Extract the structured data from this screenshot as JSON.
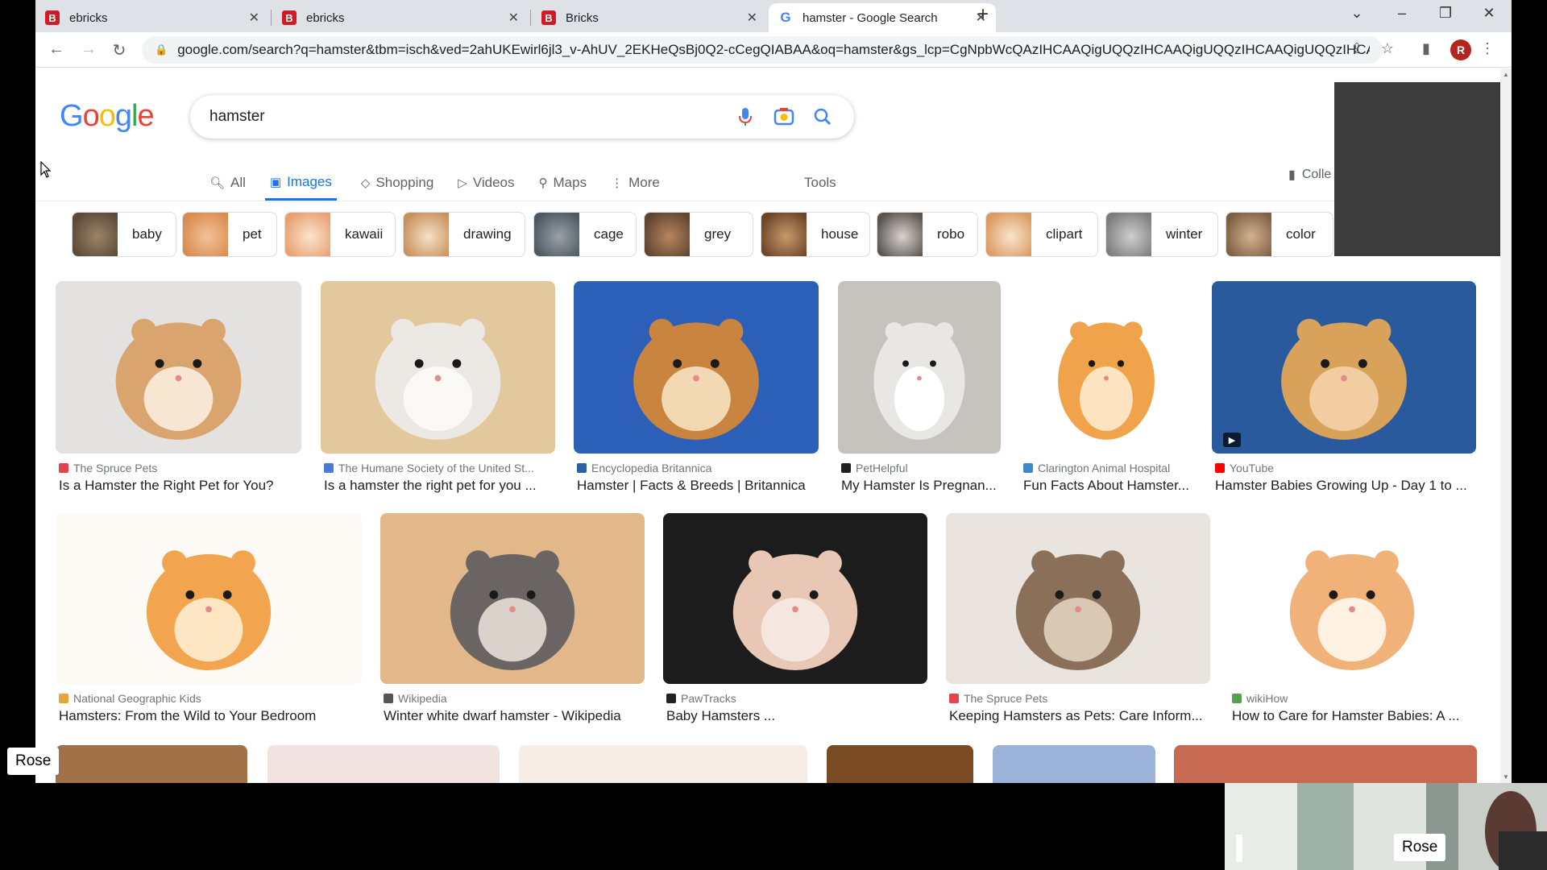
{
  "browser": {
    "tabs": [
      {
        "label": "ebricks",
        "favicon": "B"
      },
      {
        "label": "ebricks",
        "favicon": "B"
      },
      {
        "label": "Bricks",
        "favicon": "B"
      },
      {
        "label": "hamster - Google Search",
        "favicon": "G"
      }
    ],
    "new_tab": "+",
    "url": "google.com/search?q=hamster&tbm=isch&ved=2ahUKEwirl6jl3_v-AhUV_2EKHeQsBj0Q2-cCegQIABAA&oq=hamster&gs_lcp=CgNpbWcQAzIHCAAQigUQQzIHCAAQigUQQzIHCAAQigUQQzIHCA...",
    "profile_initial": "R"
  },
  "google": {
    "logo": "Google",
    "query": "hamster",
    "tabs": [
      {
        "label": "All",
        "icon": "search-icon"
      },
      {
        "label": "Images",
        "icon": "image-icon"
      },
      {
        "label": "Shopping",
        "icon": "tag-icon"
      },
      {
        "label": "Videos",
        "icon": "play-icon"
      },
      {
        "label": "Maps",
        "icon": "pin-icon"
      },
      {
        "label": "More",
        "icon": "kebab-icon"
      }
    ],
    "tools": "Tools",
    "collections": "Colle",
    "chips": [
      "baby",
      "pet",
      "kawaii",
      "drawing",
      "cage",
      "grey",
      "house",
      "robo",
      "clipart",
      "winter",
      "color"
    ],
    "results_row1": [
      {
        "source": "The Spruce Pets",
        "title": "Is a Hamster the Right Pet for You?"
      },
      {
        "source": "The Humane Society of the United St...",
        "title": "Is a hamster the right pet for you ..."
      },
      {
        "source": "Encyclopedia Britannica",
        "title": "Hamster | Facts & Breeds | Britannica"
      },
      {
        "source": "PetHelpful",
        "title": "My Hamster Is Pregnan..."
      },
      {
        "source": "Clarington Animal Hospital",
        "title": "Fun Facts About Hamster..."
      },
      {
        "source": "YouTube",
        "title": "Hamster Babies Growing Up - Day 1 to ..."
      }
    ],
    "results_row2": [
      {
        "source": "National Geographic Kids",
        "title": "Hamsters: From the Wild to Your Bedroom"
      },
      {
        "source": "Wikipedia",
        "title": "Winter white dwarf hamster - Wikipedia"
      },
      {
        "source": "PawTracks",
        "title": "Baby Hamsters ..."
      },
      {
        "source": "The Spruce Pets",
        "title": "Keeping Hamsters as Pets: Care Inform..."
      },
      {
        "source": "wikiHow",
        "title": "How to Care for Hamster Babies: A ..."
      }
    ]
  },
  "overlay": {
    "participant_left": "Rose",
    "participant_right": "Rose"
  }
}
